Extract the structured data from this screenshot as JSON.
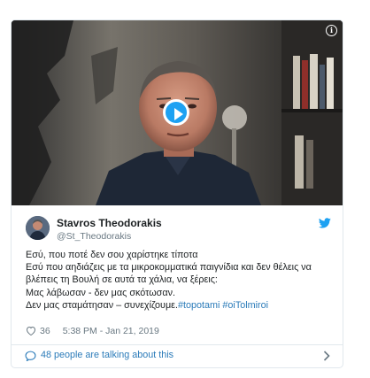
{
  "tweet": {
    "author_name": "Stavros Theodorakis",
    "author_handle": "@St_Theodorakis",
    "lines": [
      "Εσύ, που ποτέ δεν σου χαρίστηκε τίποτα",
      "Εσύ που αηδιάζεις με τα μικροκομματικά παιγνίδια και δεν θέλεις να",
      "βλέπεις τη Βουλή σε αυτά τα χάλια, να ξέρεις:",
      "Μας λάβωσαν -  δεν μας σκότωσαν."
    ],
    "last_line_text": "Δεν μας σταμάτησαν – συνεχίζουμε.",
    "hashtags": [
      "#topotami",
      "#oiTolmiroi"
    ],
    "like_count": "36",
    "timestamp": "5:38 PM - Jan 21, 2019",
    "talking_label": "48 people are talking about this"
  },
  "media": {
    "play_icon": "play-icon",
    "info_icon": "info-icon",
    "info_glyph": "i"
  },
  "icons": [
    "twitter-bird-icon",
    "heart-icon",
    "comment-bubble-icon",
    "chevron-right-icon"
  ],
  "colors": {
    "accent": "#1da1f2",
    "link": "#2b7bb9",
    "muted_text": "#697882",
    "border": "#e1e8ed"
  }
}
